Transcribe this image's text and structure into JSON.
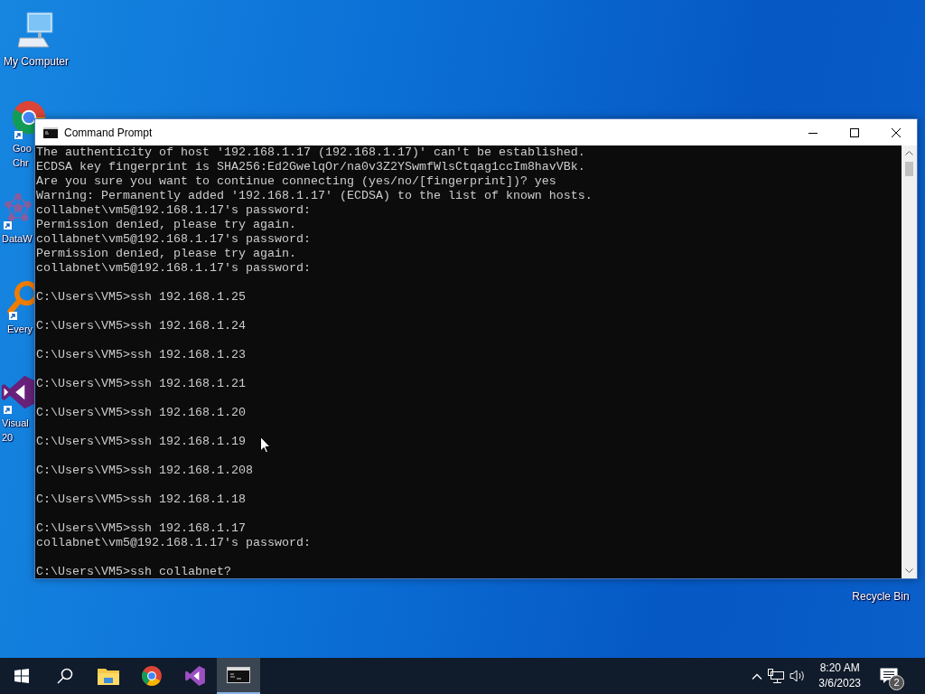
{
  "desktop_icons": [
    {
      "kind": "computer",
      "label_lines": [
        "My Computer"
      ]
    },
    {
      "kind": "chrome",
      "label_lines": [
        "Goo",
        "Chr"
      ]
    },
    {
      "kind": "datawrapper",
      "label_lines": [
        "DataW"
      ]
    },
    {
      "kind": "everything",
      "label_lines": [
        "Every"
      ]
    },
    {
      "kind": "visualstudio",
      "label_lines": [
        "Visual",
        "20"
      ]
    },
    {
      "kind": "recycle",
      "label_lines": [
        "Recycle Bin"
      ]
    }
  ],
  "window": {
    "title": "Command Prompt",
    "lines": [
      {
        "kind": "output",
        "text": "The authenticity of host '192.168.1.17 (192.168.1.17)' can't be established."
      },
      {
        "kind": "output",
        "text": "ECDSA key fingerprint is SHA256:Ed2GwelqOr/na0v3Z2YSwmfWlsCtqag1ccIm8havVBk."
      },
      {
        "kind": "output",
        "text": "Are you sure you want to continue connecting (yes/no/[fingerprint])? yes"
      },
      {
        "kind": "output",
        "text": "Warning: Permanently added '192.168.1.17' (ECDSA) to the list of known hosts."
      },
      {
        "kind": "output",
        "text": "collabnet\\vm5@192.168.1.17's password:"
      },
      {
        "kind": "output",
        "text": "Permission denied, please try again."
      },
      {
        "kind": "output",
        "text": "collabnet\\vm5@192.168.1.17's password:"
      },
      {
        "kind": "output",
        "text": "Permission denied, please try again."
      },
      {
        "kind": "output",
        "text": "collabnet\\vm5@192.168.1.17's password:"
      },
      {
        "kind": "prompt",
        "text": "C:\\Users\\VM5>ssh 192.168.1.25"
      },
      {
        "kind": "prompt",
        "text": "C:\\Users\\VM5>ssh 192.168.1.24"
      },
      {
        "kind": "prompt",
        "text": "C:\\Users\\VM5>ssh 192.168.1.23"
      },
      {
        "kind": "prompt",
        "text": "C:\\Users\\VM5>ssh 192.168.1.21"
      },
      {
        "kind": "prompt",
        "text": "C:\\Users\\VM5>ssh 192.168.1.20"
      },
      {
        "kind": "prompt",
        "text": "C:\\Users\\VM5>ssh 192.168.1.19"
      },
      {
        "kind": "prompt",
        "text": "C:\\Users\\VM5>ssh 192.168.1.208"
      },
      {
        "kind": "prompt",
        "text": "C:\\Users\\VM5>ssh 192.168.1.18"
      },
      {
        "kind": "prompt",
        "text": "C:\\Users\\VM5>ssh 192.168.1.17"
      },
      {
        "kind": "output",
        "text": "collabnet\\vm5@192.168.1.17's password:"
      },
      {
        "kind": "prompt",
        "text": "C:\\Users\\VM5>ssh collabnet?"
      }
    ]
  },
  "taskbar": {
    "apps": [
      {
        "kind": "explorer",
        "selected": false
      },
      {
        "kind": "chrome",
        "selected": false
      },
      {
        "kind": "visualstudio",
        "selected": false
      },
      {
        "kind": "cmd",
        "selected": true
      }
    ],
    "clock": {
      "time": "8:20 AM",
      "date": "3/6/2023"
    },
    "notifications": "2"
  }
}
